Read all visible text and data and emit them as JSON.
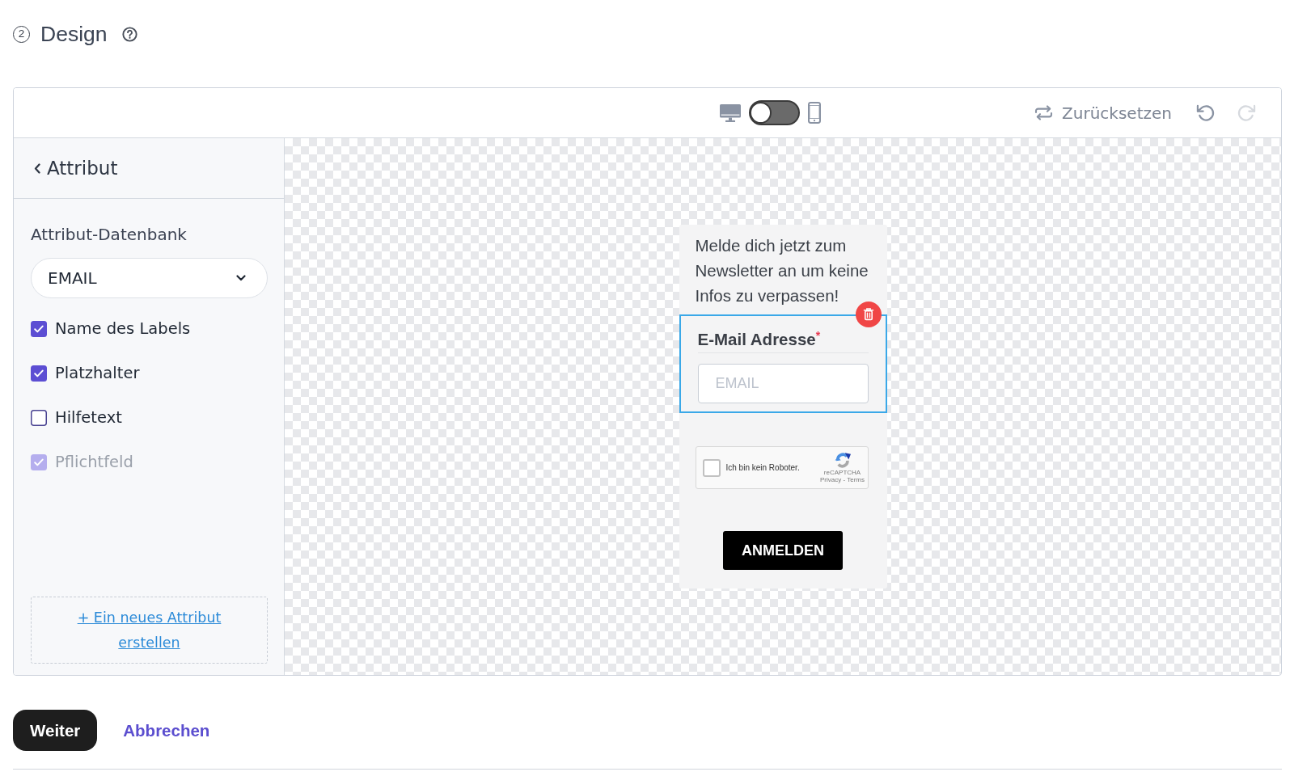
{
  "header": {
    "step_number": "2",
    "title": "Design"
  },
  "editor": {
    "toolbar": {
      "view_switch": {
        "mobile": false
      },
      "reset_label": "Zurücksetzen",
      "undo": {
        "disabled": false
      },
      "redo": {
        "disabled": true
      }
    },
    "sidebar": {
      "back_label": "Attribut",
      "field_label": "Attribut-Datenbank",
      "select_value": "EMAIL",
      "options": [
        {
          "label": "Name des Labels",
          "checked": true,
          "disabled": false
        },
        {
          "label": "Platzhalter",
          "checked": true,
          "disabled": false
        },
        {
          "label": "Hilfetext",
          "checked": false,
          "disabled": false
        },
        {
          "label": "Pflichtfeld",
          "checked": true,
          "disabled": true
        }
      ],
      "create_link": "+ Ein neues Attribut erstellen"
    },
    "preview": {
      "intro": "Melde dich jetzt zum Newsletter an um keine Infos zu verpassen!",
      "field": {
        "label": "E-Mail Adresse",
        "required_mark": "*",
        "placeholder": "EMAIL",
        "selected": true
      },
      "captcha": {
        "checked": false,
        "label": "Ich bin kein Roboter.",
        "brand": "reCAPTCHA",
        "links": "Privacy - Terms"
      },
      "submit_label": "ANMELDEN"
    }
  },
  "actions": {
    "next_label": "Weiter",
    "cancel_label": "Abbrechen"
  }
}
